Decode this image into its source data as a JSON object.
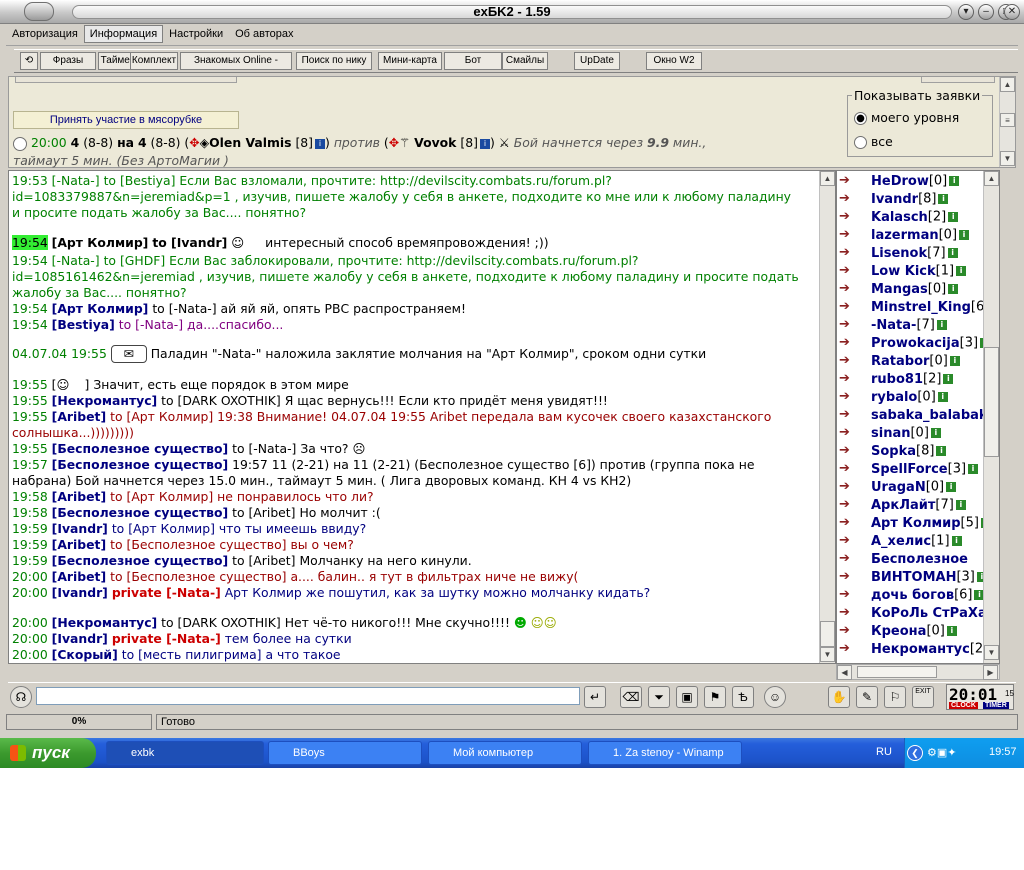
{
  "window": {
    "title": "exБK2 - 1.59"
  },
  "menu": [
    "Авторизация",
    "Информация",
    "Настройки",
    "Об авторах"
  ],
  "toolbar": [
    "Фразы",
    "Таймер",
    "Комплект",
    "Знакомых Online -",
    "Поиск по нику",
    "Мини-карта",
    "Бот",
    "Смайлы",
    "UpDate",
    "Окно W2"
  ],
  "info": {
    "join_button": "Принять участие в мясорубке",
    "battle": {
      "time": "20:00",
      "count1": "4",
      "range1": "(8-8)",
      "on": "на",
      "count2": "4",
      "range2": "(8-8)",
      "player1": "Olen Valmis",
      "level1": "[8]",
      "vs": "против",
      "player2": "Vovok",
      "level2": "[8]",
      "starts": "Бой начнется через",
      "mins": "9.9",
      "mins_unit": "мин.,",
      "line2": "таймаут 5 мин. (Без АртоМагии )"
    },
    "show_requests": {
      "title": "Показывать заявки",
      "opt1": "моего уровня",
      "opt2": "все",
      "selected": 1
    }
  },
  "chat": [
    {
      "t": "19:53",
      "nick": "[-Nata-]",
      "to": "to [Bestiya] Если Вас взломали, прочтите: http://devilscity.combats.ru/forum.pl?id=1083379887&n=jeremiad&p=1 , изучив, пишете жалобу у себя в анкете, подходите ко мне или к любому паладину и просите подать жалобу за Вас.... понятно?"
    },
    {
      "t": "19:54",
      "nick": "[Арт Колмир]",
      "to": "to [Ivandr]",
      "msg": "интересный способ времяпровождения! ;))"
    },
    {
      "t": "19:54",
      "nick": "[-Nata-]",
      "to": "to [GHDF] Если Вас заблокировали, прочтите: http://devilscity.combats.ru/forum.pl?id=1085161462&n=jeremiad , изучив, пишете жалобу у себя в анкете, подходите к любому паладину и просите подать жалобу за Вас.... понятно?"
    },
    {
      "t": "19:54",
      "nick": "[Арт Колмир]",
      "msg": "to [-Nata-] ай яй яй, опять РВС распространяем!"
    },
    {
      "t": "19:54",
      "nick": "[Bestiya]",
      "msg": "to [-Nata-] да....спасибо..."
    },
    {
      "t": "04.07.04 19:55",
      "msg": "Паладин \"-Nata-\" наложила заклятие молчания на \"Арт Колмир\", сроком одни сутки"
    },
    {
      "t": "19:55",
      "open": "[",
      "close": "]",
      "msg": "Значит, есть еще порядок в этом мире"
    },
    {
      "t": "19:55",
      "nick": "[Некромантус]",
      "msg": "to [DARK OXOTHIK] Я щас вернусь!!! Если кто придёт меня увидят!!!"
    },
    {
      "t": "19:55",
      "nick": "[Aribet]",
      "msg": "to [Арт Колмир] 19:38 Внимание! 04.07.04 19:55 Aribet передала вам кусочек своего казахстанского солнышка...)))))))))"
    },
    {
      "t": "19:55",
      "nick": "[Бесполезное существо]",
      "msg": "to [-Nata-] За что?"
    },
    {
      "t": "19:57",
      "nick": "[Бесполезное существо]",
      "msg": "19:57 11 (2-21) на 11 (2-21) (Бесполезное существо [6]) против (группа пока не набрана) Бой начнется через 15.0 мин., таймаут 5 мин. ( Лига дворовых команд. КН 4 vs КН2)"
    },
    {
      "t": "19:58",
      "nick": "[Aribet]",
      "msg": "to [Арт Колмир] не понравилось что ли?"
    },
    {
      "t": "19:58",
      "nick": "[Бесполезное существо]",
      "msg": "to [Aribet] Но молчит :("
    },
    {
      "t": "19:59",
      "nick": "[Ivandr]",
      "msg": "to [Арт Колмир] что ты имеешь ввиду?"
    },
    {
      "t": "19:59",
      "nick": "[Aribet]",
      "msg": "to [Бесполезное существо] вы о чем?"
    },
    {
      "t": "19:59",
      "nick": "[Бесполезное существо]",
      "msg": "to [Aribet] Молчанку на него кинули."
    },
    {
      "t": "20:00",
      "nick": "[Aribet]",
      "msg": "to [Бесполезное существо] а.... балин.. я тут в фильтрах ниче не вижу("
    },
    {
      "t": "20:00",
      "nick": "[Ivandr]",
      "private": "private [-Nata-]",
      "msg": "Арт Колмир же пошутил, как за шутку можно молчанку кидать?"
    },
    {
      "t": "20:00",
      "nick": "[Некромантус]",
      "msg": "to [DARK OXOTHIK] Нет чё-то никого!!! Мне скучно!!!!"
    },
    {
      "t": "20:00",
      "nick": "[Ivandr]",
      "private": "private [-Nata-]",
      "msg": "тем более на сутки"
    },
    {
      "t": "20:00",
      "nick": "[Скорый]",
      "msg": "to [месть пилигрима] а что такое"
    }
  ],
  "users": [
    {
      "n": "HeDrow",
      "l": "[0]"
    },
    {
      "n": "Ivandr",
      "l": "[8]"
    },
    {
      "n": "Kalasch",
      "l": "[2]"
    },
    {
      "n": "lazerman",
      "l": "[0]"
    },
    {
      "n": "Lisenok",
      "l": "[7]"
    },
    {
      "n": "Low Kick",
      "l": "[1]"
    },
    {
      "n": "Mangas",
      "l": "[0]"
    },
    {
      "n": "Minstrel_King",
      "l": "[6]"
    },
    {
      "n": "-Nata-",
      "l": "[7]"
    },
    {
      "n": "Prowokacija",
      "l": "[3]"
    },
    {
      "n": "Ratabor",
      "l": "[0]"
    },
    {
      "n": "rubo81",
      "l": "[2]"
    },
    {
      "n": "rybalo",
      "l": "[0]"
    },
    {
      "n": "sabaka_balabaka",
      "l": ""
    },
    {
      "n": "sinan",
      "l": "[0]"
    },
    {
      "n": "Sopka",
      "l": "[8]"
    },
    {
      "n": "SpellForce",
      "l": "[3]"
    },
    {
      "n": "UragaN",
      "l": "[0]"
    },
    {
      "n": "АркЛайт",
      "l": "[7]"
    },
    {
      "n": "Арт Колмир",
      "l": "[5]"
    },
    {
      "n": "А_хелис",
      "l": "[1]"
    },
    {
      "n": "Бесполезное",
      "l": ""
    },
    {
      "n": "ВИНТОМАН",
      "l": "[3]"
    },
    {
      "n": "дочь богов",
      "l": "[6]"
    },
    {
      "n": "КоРоЛь СтРаХа",
      "l": "[0"
    },
    {
      "n": "Креона",
      "l": "[0]"
    },
    {
      "n": "Некромантус",
      "l": "[2]"
    }
  ],
  "clock": {
    "time": "20:01",
    "sec": "15",
    "clock_label": "CLOCK",
    "timer_label": "TIMER",
    "exit_label": "EXIT"
  },
  "status": {
    "progress": "0%",
    "progress_value": 0,
    "text": "Готово"
  },
  "taskbar": {
    "start": "пуск",
    "tasks": [
      "exbk",
      "BBoys",
      "Мой компьютер",
      "1. Za stenoy - Winamp"
    ],
    "lang": "RU",
    "time": "19:57"
  }
}
